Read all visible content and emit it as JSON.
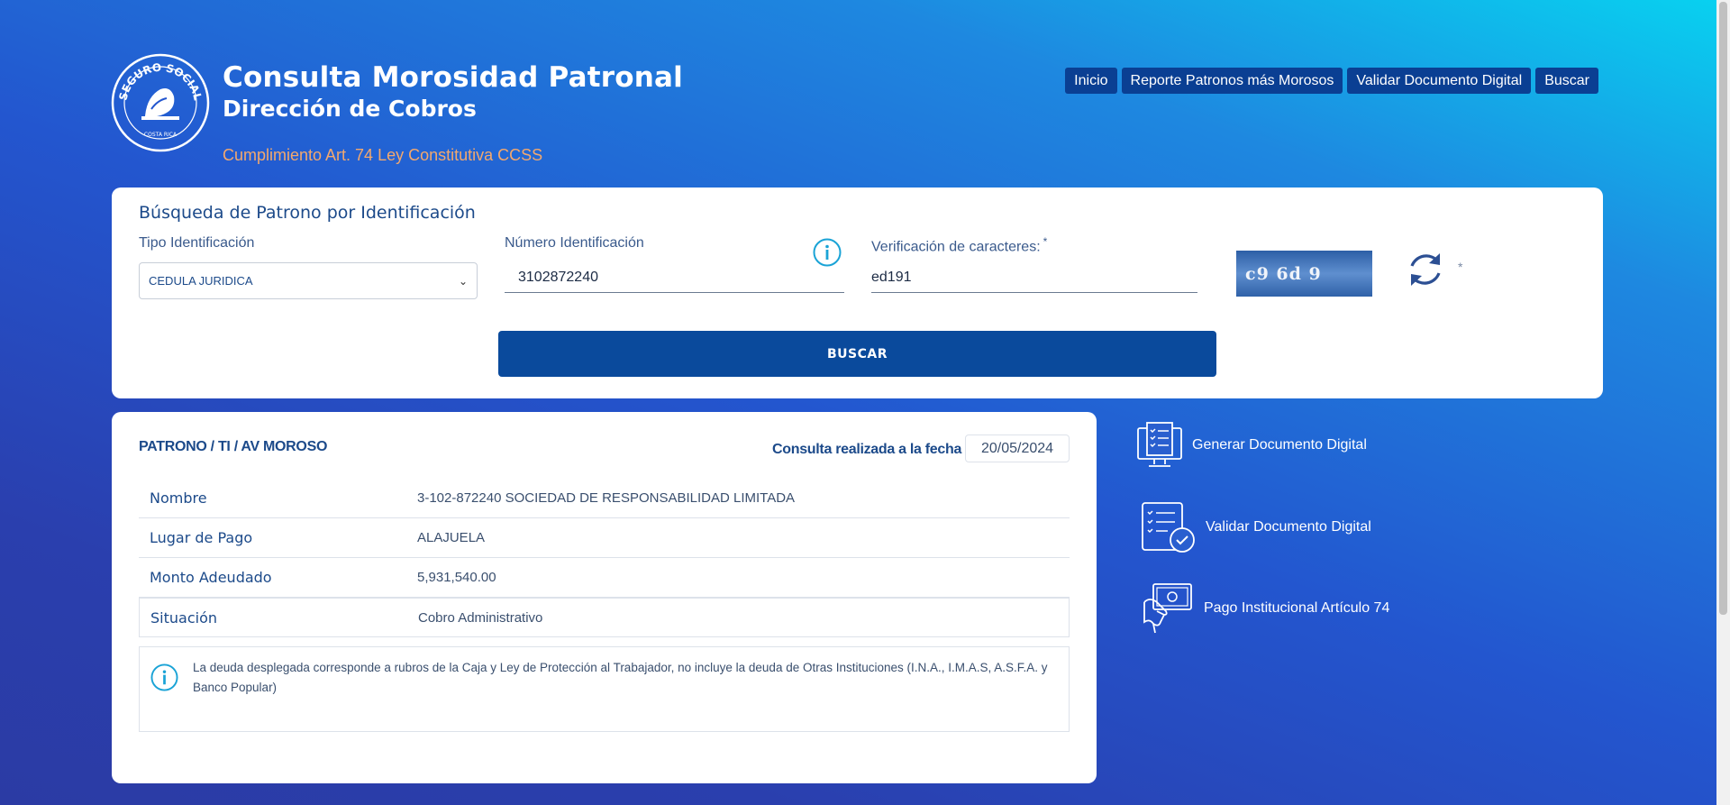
{
  "header": {
    "title": "Consulta Morosidad Patronal",
    "subtitle": "Dirección de Cobros",
    "law": "Cumplimiento Art. 74 Ley Constitutiva CCSS",
    "logo": {
      "text_top": "SEGURO SOCIAL",
      "text_bottom": "COSTA RICA",
      "icon": "ccss-logo"
    }
  },
  "nav": [
    {
      "label": "Inicio"
    },
    {
      "label": "Reporte Patronos más Morosos"
    },
    {
      "label": "Validar Documento Digital"
    },
    {
      "label": "Buscar"
    }
  ],
  "search": {
    "heading": "Búsqueda de Patrono por Identificación",
    "tipo_label": "Tipo Identificación",
    "tipo_value": "CEDULA JURIDICA",
    "numero_label": "Número Identificación",
    "numero_value": "3102872240",
    "verif_label": "Verificación de caracteres:",
    "required_mark": "*",
    "verif_value": "ed191",
    "captcha_text": "c9 6d 9",
    "button": "BUSCAR"
  },
  "result": {
    "heading": "PATRONO / TI / AV MOROSO",
    "fecha_label": "Consulta realizada a la fecha",
    "fecha_value": "20/05/2024",
    "rows": [
      {
        "key": "Nombre",
        "value": "3-102-872240 SOCIEDAD DE RESPONSABILIDAD LIMITADA"
      },
      {
        "key": "Lugar de Pago",
        "value": "ALAJUELA"
      },
      {
        "key": "Monto Adeudado",
        "value": "5,931,540.00"
      },
      {
        "key": "Situación",
        "value": "Cobro Administrativo"
      }
    ],
    "notice": "La deuda desplegada corresponde a rubros de la Caja y Ley de Protección al Trabajador, no incluye la deuda de Otras Instituciones (I.N.A., I.M.A.S, A.S.F.A. y Banco Popular)"
  },
  "side_links": [
    {
      "label": "Generar Documento Digital",
      "icon": "computer-document-icon"
    },
    {
      "label": "Validar Documento Digital",
      "icon": "checklist-check-icon"
    },
    {
      "label": "Pago Institucional Artículo 74",
      "icon": "hand-money-icon"
    }
  ],
  "colors": {
    "primary": "#0a4a9c",
    "accent_orange": "#f3a86e",
    "info": "#1aa3d6"
  }
}
